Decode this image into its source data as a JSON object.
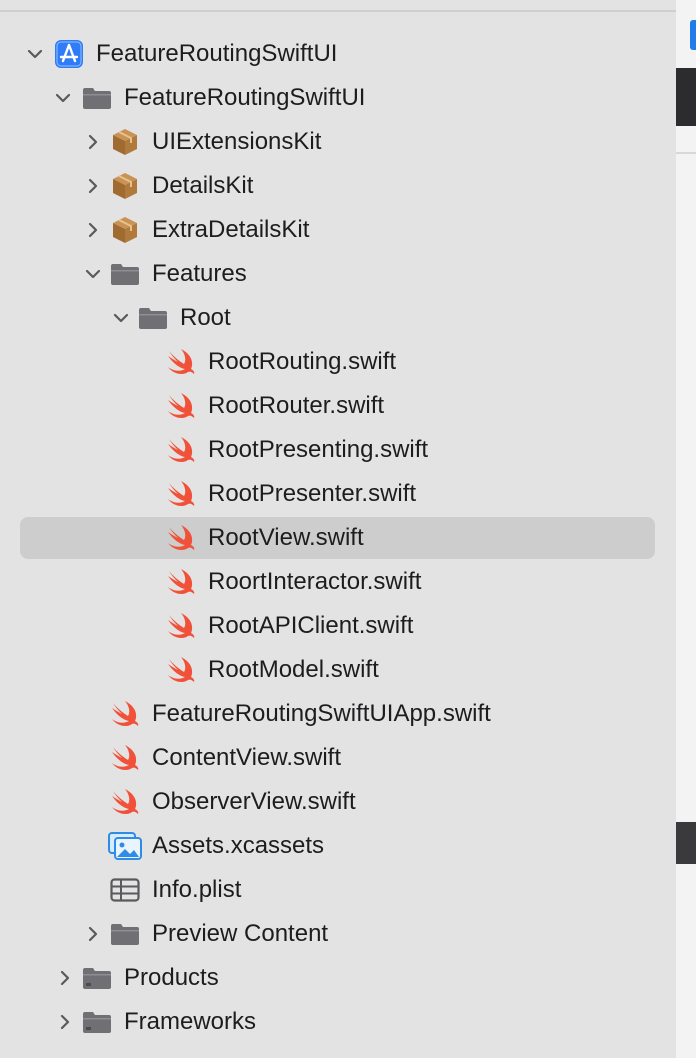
{
  "navigator": {
    "items": [
      {
        "label": "FeatureRoutingSwiftUI",
        "icon": "xcode-app-icon",
        "chevron": "down"
      },
      {
        "label": "FeatureRoutingSwiftUI",
        "icon": "folder-icon",
        "chevron": "down"
      },
      {
        "label": "UIExtensionsKit",
        "icon": "package-icon",
        "chevron": "right"
      },
      {
        "label": "DetailsKit",
        "icon": "package-icon",
        "chevron": "right"
      },
      {
        "label": "ExtraDetailsKit",
        "icon": "package-icon",
        "chevron": "right"
      },
      {
        "label": "Features",
        "icon": "folder-icon",
        "chevron": "down"
      },
      {
        "label": "Root",
        "icon": "folder-icon",
        "chevron": "down"
      },
      {
        "label": "RootRouting.swift",
        "icon": "swift-file-icon"
      },
      {
        "label": "RootRouter.swift",
        "icon": "swift-file-icon"
      },
      {
        "label": "RootPresenting.swift",
        "icon": "swift-file-icon"
      },
      {
        "label": "RootPresenter.swift",
        "icon": "swift-file-icon"
      },
      {
        "label": "RootView.swift",
        "icon": "swift-file-icon",
        "selected": true
      },
      {
        "label": "RoortInteractor.swift",
        "icon": "swift-file-icon"
      },
      {
        "label": "RootAPIClient.swift",
        "icon": "swift-file-icon"
      },
      {
        "label": "RootModel.swift",
        "icon": "swift-file-icon"
      },
      {
        "label": "FeatureRoutingSwiftUIApp.swift",
        "icon": "swift-file-icon"
      },
      {
        "label": "ContentView.swift",
        "icon": "swift-file-icon"
      },
      {
        "label": "ObserverView.swift",
        "icon": "swift-file-icon"
      },
      {
        "label": "Assets.xcassets",
        "icon": "asset-catalog-icon"
      },
      {
        "label": "Info.plist",
        "icon": "plist-icon"
      },
      {
        "label": "Preview Content",
        "icon": "folder-icon",
        "chevron": "right"
      },
      {
        "label": "Products",
        "icon": "folder-icon",
        "chevron": "right"
      },
      {
        "label": "Frameworks",
        "icon": "folder-icon",
        "chevron": "right"
      }
    ]
  },
  "colors": {
    "background": "#e3e3e3",
    "selection": "#cdcdcd",
    "swift_orange": "#f05138",
    "folder_gray": "#6f6f74",
    "package_brown": "#b07a3c",
    "app_blue": "#2f7cf6",
    "text": "#1d1d1f"
  }
}
